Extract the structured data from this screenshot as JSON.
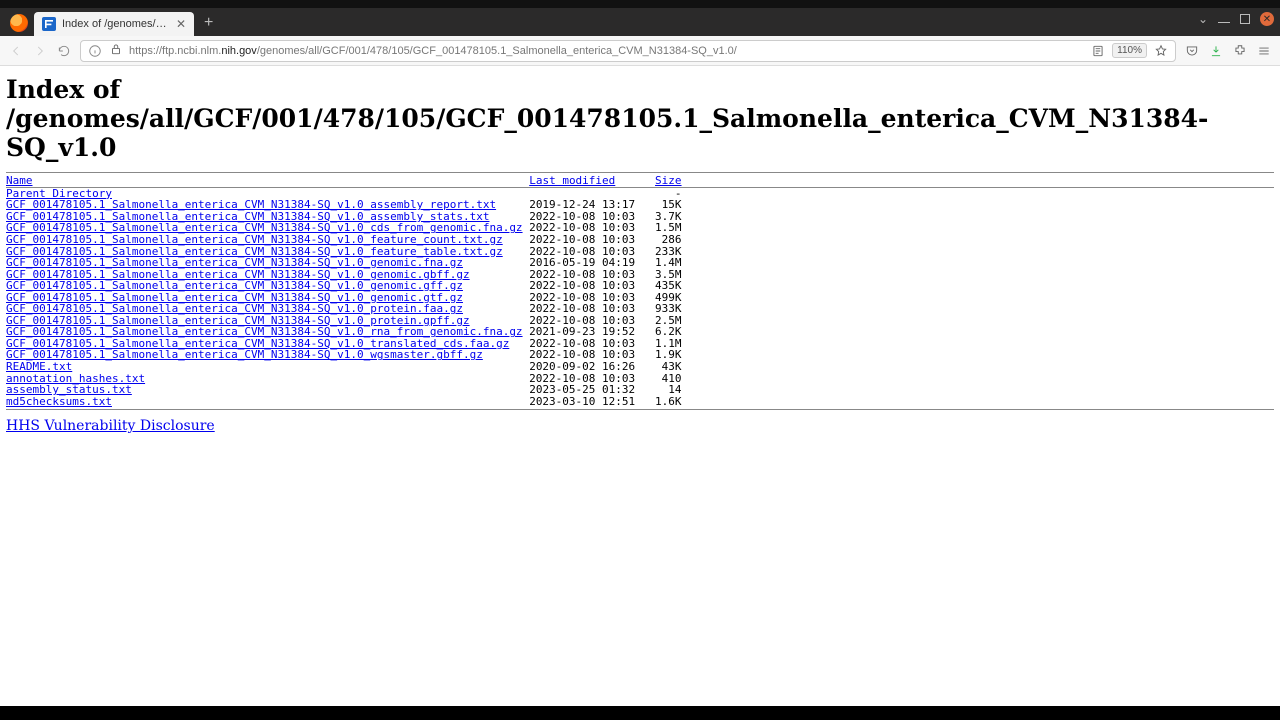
{
  "browser": {
    "tab_title": "Index of /genomes/all/G",
    "url_prefix": "https://ftp.ncbi.nlm.",
    "url_host_bold": "nih.gov",
    "url_path": "/genomes/all/GCF/001/478/105/GCF_001478105.1_Salmonella_enterica_CVM_N31384-SQ_v1.0/",
    "zoom": "110%"
  },
  "page": {
    "heading": "Index of /genomes/all/GCF/001/478/105/GCF_001478105.1_Salmonella_enterica_CVM_N31384-SQ_v1.0",
    "col_name": "Name",
    "col_modified": "Last modified",
    "col_size": "Size",
    "parent_dir": "Parent Directory",
    "files": [
      {
        "name": "GCF_001478105.1_Salmonella_enterica_CVM_N31384-SQ_v1.0_assembly_report.txt",
        "mod": "2019-12-24 13:17",
        "size": "15K"
      },
      {
        "name": "GCF_001478105.1_Salmonella_enterica_CVM_N31384-SQ_v1.0_assembly_stats.txt",
        "mod": "2022-10-08 10:03",
        "size": "3.7K"
      },
      {
        "name": "GCF_001478105.1_Salmonella_enterica_CVM_N31384-SQ_v1.0_cds_from_genomic.fna.gz",
        "mod": "2022-10-08 10:03",
        "size": "1.5M"
      },
      {
        "name": "GCF_001478105.1_Salmonella_enterica_CVM_N31384-SQ_v1.0_feature_count.txt.gz",
        "mod": "2022-10-08 10:03",
        "size": "286"
      },
      {
        "name": "GCF_001478105.1_Salmonella_enterica_CVM_N31384-SQ_v1.0_feature_table.txt.gz",
        "mod": "2022-10-08 10:03",
        "size": "233K"
      },
      {
        "name": "GCF_001478105.1_Salmonella_enterica_CVM_N31384-SQ_v1.0_genomic.fna.gz",
        "mod": "2016-05-19 04:19",
        "size": "1.4M"
      },
      {
        "name": "GCF_001478105.1_Salmonella_enterica_CVM_N31384-SQ_v1.0_genomic.gbff.gz",
        "mod": "2022-10-08 10:03",
        "size": "3.5M"
      },
      {
        "name": "GCF_001478105.1_Salmonella_enterica_CVM_N31384-SQ_v1.0_genomic.gff.gz",
        "mod": "2022-10-08 10:03",
        "size": "435K"
      },
      {
        "name": "GCF_001478105.1_Salmonella_enterica_CVM_N31384-SQ_v1.0_genomic.gtf.gz",
        "mod": "2022-10-08 10:03",
        "size": "499K"
      },
      {
        "name": "GCF_001478105.1_Salmonella_enterica_CVM_N31384-SQ_v1.0_protein.faa.gz",
        "mod": "2022-10-08 10:03",
        "size": "933K"
      },
      {
        "name": "GCF_001478105.1_Salmonella_enterica_CVM_N31384-SQ_v1.0_protein.gpff.gz",
        "mod": "2022-10-08 10:03",
        "size": "2.5M"
      },
      {
        "name": "GCF_001478105.1_Salmonella_enterica_CVM_N31384-SQ_v1.0_rna_from_genomic.fna.gz",
        "mod": "2021-09-23 19:52",
        "size": "6.2K"
      },
      {
        "name": "GCF_001478105.1_Salmonella_enterica_CVM_N31384-SQ_v1.0_translated_cds.faa.gz",
        "mod": "2022-10-08 10:03",
        "size": "1.1M"
      },
      {
        "name": "GCF_001478105.1_Salmonella_enterica_CVM_N31384-SQ_v1.0_wgsmaster.gbff.gz",
        "mod": "2022-10-08 10:03",
        "size": "1.9K"
      },
      {
        "name": "README.txt",
        "mod": "2020-09-02 16:26",
        "size": "43K"
      },
      {
        "name": "annotation_hashes.txt",
        "mod": "2022-10-08 10:03",
        "size": "410"
      },
      {
        "name": "assembly_status.txt",
        "mod": "2023-05-25 01:32",
        "size": "14"
      },
      {
        "name": "md5checksums.txt",
        "mod": "2023-03-10 12:51",
        "size": "1.6K"
      }
    ],
    "footer_link": "HHS Vulnerability Disclosure"
  }
}
